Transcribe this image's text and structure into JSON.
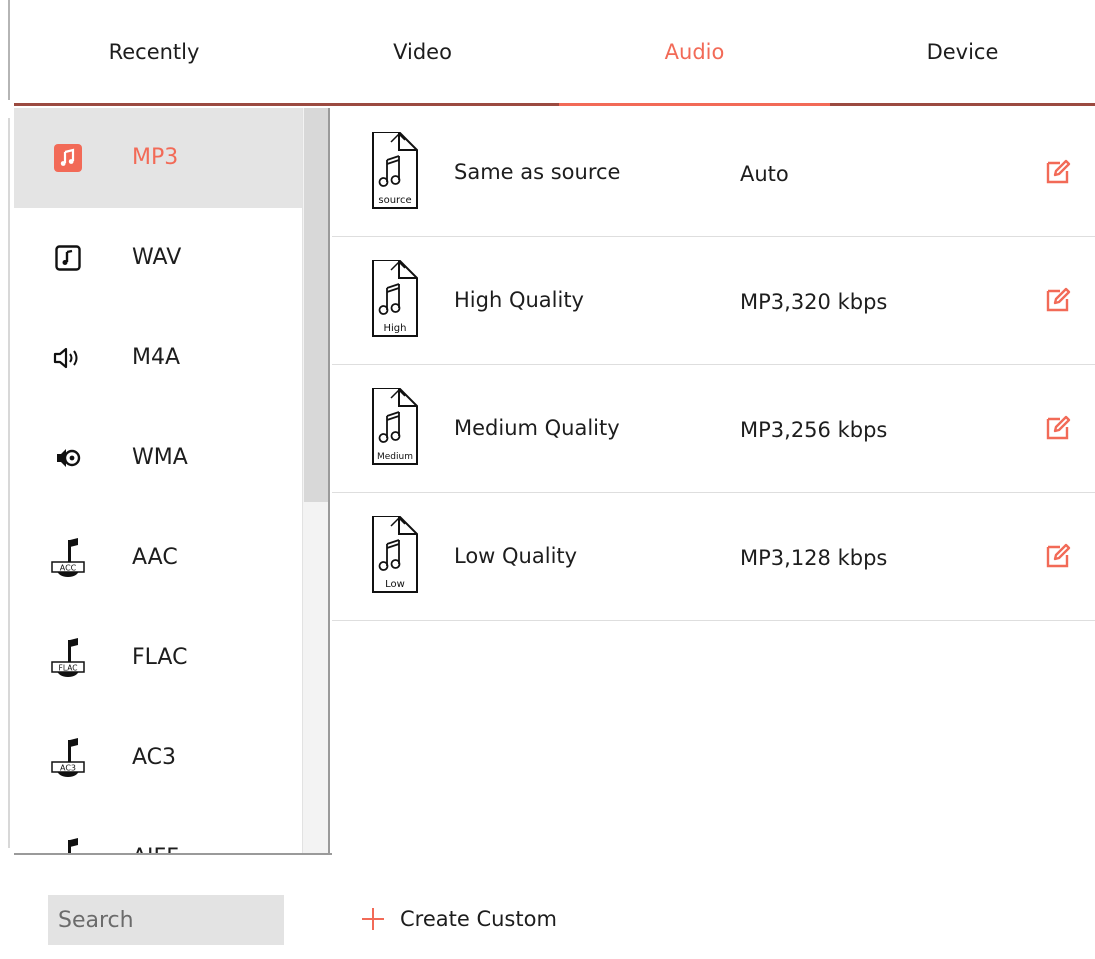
{
  "tabs": [
    {
      "label": "Recently"
    },
    {
      "label": "Video"
    },
    {
      "label": "Audio"
    },
    {
      "label": "Device"
    }
  ],
  "formats": [
    {
      "label": "MP3",
      "icon": "music-note-square-icon"
    },
    {
      "label": "WAV",
      "icon": "music-note-outline-icon"
    },
    {
      "label": "M4A",
      "icon": "speaker-icon"
    },
    {
      "label": "WMA",
      "icon": "speaker-circle-icon"
    },
    {
      "label": "AAC",
      "icon": "note-aac-icon",
      "badge": "ACC"
    },
    {
      "label": "FLAC",
      "icon": "note-flac-icon",
      "badge": "FLAC"
    },
    {
      "label": "AC3",
      "icon": "note-ac3-icon",
      "badge": "AC3"
    },
    {
      "label": "AIFF",
      "icon": "note-aiff-icon"
    }
  ],
  "presets": [
    {
      "name": "Same as source",
      "value": "Auto",
      "icon_label": "source"
    },
    {
      "name": "High Quality",
      "value": "MP3,320 kbps",
      "icon_label": "High"
    },
    {
      "name": "Medium Quality",
      "value": "MP3,256 kbps",
      "icon_label": "Medium"
    },
    {
      "name": "Low Quality",
      "value": "MP3,128 kbps",
      "icon_label": "Low"
    }
  ],
  "search": {
    "placeholder": "Search"
  },
  "create_custom": {
    "label": "Create Custom"
  },
  "colors": {
    "accent": "#f26a57",
    "selected_bg": "#e4e4e4",
    "underline": "#9b4a40"
  }
}
